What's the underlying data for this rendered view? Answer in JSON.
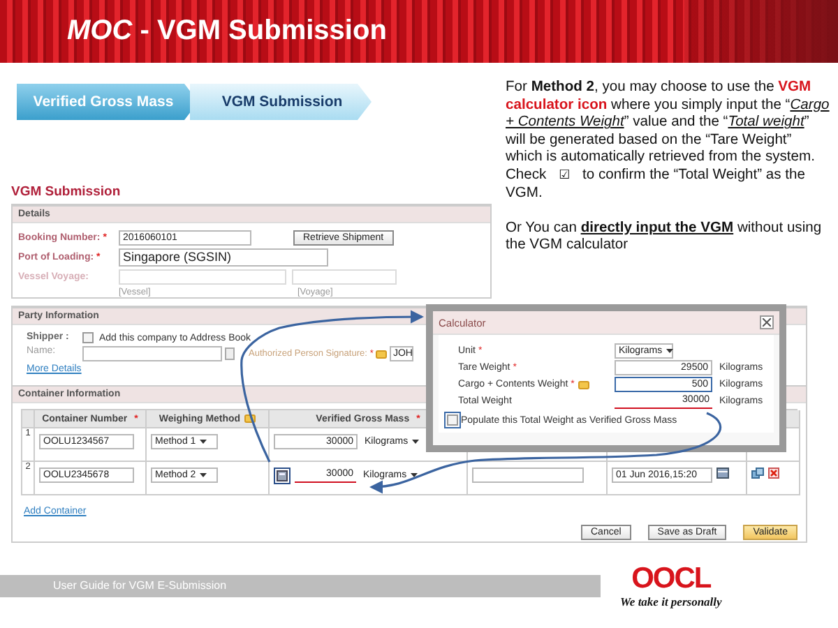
{
  "header": {
    "title_prefix": "MOC",
    "title": " - VGM Submission"
  },
  "breadcrumb": [
    {
      "label": "Verified Gross Mass",
      "selected": false
    },
    {
      "label": "VGM Submission",
      "selected": true
    }
  ],
  "note": {
    "sections": [
      [
        [
          {
            "text": "For ",
            "kind": "plain"
          },
          {
            "text": "Method 2",
            "kind": "bold"
          },
          {
            "text": ", you may choose to use the ",
            "kind": "plain"
          },
          {
            "text": "VGM calculator icon",
            "kind": "red-bold"
          },
          {
            "text": " where you simply input the “",
            "kind": "plain"
          },
          {
            "text": "Cargo + Contents Weight",
            "kind": "italic-underline"
          },
          {
            "text": "” value and the “",
            "kind": "plain"
          },
          {
            "text": "Total weight",
            "kind": "italic-underline"
          },
          {
            "text": "” will be generated based on the “Tare Weight” which is automatically retrieved from the system.",
            "kind": "plain"
          }
        ],
        [
          {
            "text": "Check ",
            "kind": "plain"
          },
          {
            "text": "☑",
            "kind": "symbol"
          },
          {
            "text": " to confirm the “Total Weight” as the VGM.",
            "kind": "plain"
          }
        ]
      ],
      [
        [
          {
            "text": "Or You can ",
            "kind": "plain"
          },
          {
            "text": "directly input the VGM",
            "kind": "bold-underline"
          },
          {
            "text": " without using the VGM calculator",
            "kind": "plain"
          }
        ]
      ]
    ]
  },
  "form": {
    "title": "VGM Submission",
    "details": {
      "title": "Details",
      "booking": {
        "label": "Booking Number:",
        "mark": "*",
        "value": "2016060101",
        "disabled": false
      },
      "retrieve_button": "Retrieve Shipment",
      "port": {
        "label": "Port of Loading:",
        "mark": "*",
        "value": "Singapore (SGSIN)",
        "disabled": false
      },
      "vessel": {
        "label": "Vessel Voyage:",
        "disabled": true
      },
      "vessel_hint": "[Vessel]",
      "voyage_hint": "[Voyage]"
    },
    "party": {
      "title": "Party Information",
      "shipper_label": "Shipper :",
      "add_checkbox": {
        "label": "Add this company to Address Book",
        "checked": false
      },
      "name_label": "Name:",
      "signature_label": "Authorized Person Signature:",
      "signature_mark": "*",
      "signature_value": "JOH",
      "more_details": "More Details"
    },
    "container": {
      "title": "Container Information",
      "columns": [
        {
          "label": "Container Number",
          "mark": "*"
        },
        {
          "label": "Weighing Method"
        },
        {
          "label": "Verified Gross Mass",
          "mark": "*"
        }
      ],
      "rows": [
        {
          "number": "1",
          "container": "OOLU1234567",
          "method": "Method 1",
          "calculator": false,
          "vgm": "30000",
          "unit": "Kilograms",
          "highlighted": false
        },
        {
          "number": "2",
          "container": "OOLU2345678",
          "method": "Method 2",
          "calculator": true,
          "vgm": "30000",
          "unit": "Kilograms",
          "highlighted": true,
          "datetime": "01 Jun 2016,15:20"
        }
      ],
      "add_container": "Add Container"
    },
    "buttons": [
      {
        "label": "Cancel",
        "kind": "plain"
      },
      {
        "label": "Save as Draft",
        "kind": "plain"
      },
      {
        "label": "Validate",
        "kind": "primary"
      }
    ]
  },
  "calculator": {
    "title": "Calculator",
    "rows": [
      {
        "kind": "select",
        "label": "Unit",
        "mark": "*",
        "value": "Kilograms",
        "focused": false,
        "highlighted": false
      },
      {
        "kind": "input",
        "label": "Tare Weight",
        "mark": "*",
        "value": "29500",
        "unit": "Kilograms",
        "focused": false,
        "highlighted": false
      },
      {
        "kind": "input",
        "label": "Cargo + Contents Weight",
        "mark": "*",
        "value": "500",
        "unit": "Kilograms",
        "focused": true,
        "highlighted": false,
        "tip": true
      },
      {
        "kind": "total",
        "label": "Total Weight",
        "value": "30000",
        "unit": "Kilograms",
        "focused": false,
        "highlighted": true
      }
    ],
    "populate": {
      "label": "Populate this Total Weight as Verified Gross Mass",
      "checked": false
    }
  },
  "footer": {
    "text": "User Guide for VGM E-Submission",
    "logo": "OOCL",
    "slogan": "We take it personally"
  }
}
